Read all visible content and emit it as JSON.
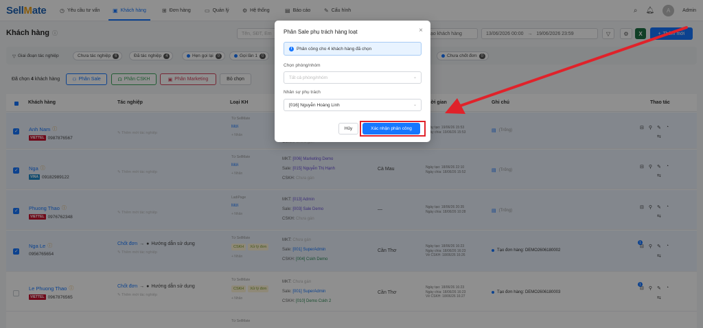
{
  "brand": {
    "logo_left": "Sell",
    "logo_mid": "M",
    "logo_right": "ate"
  },
  "nav": [
    {
      "label": "Yêu cầu tư vấn",
      "icon": "clock-icon"
    },
    {
      "label": "Khách hàng",
      "icon": "contacts-icon"
    },
    {
      "label": "Đơn hàng",
      "icon": "cart-icon"
    },
    {
      "label": "Quản lý",
      "icon": "folder-icon"
    },
    {
      "label": "Hệ thống",
      "icon": "gear-icon"
    },
    {
      "label": "Báo cáo",
      "icon": "chart-icon"
    },
    {
      "label": "Cấu hình",
      "icon": "wrench-icon"
    }
  ],
  "user": {
    "initial": "A",
    "name": "Admin"
  },
  "page": {
    "title": "Khách hàng",
    "search_placeholder": "Tên, SĐT, Em",
    "date_type": "tạo khách hàng",
    "date_from": "13/06/2026 00:00",
    "date_sep": "→",
    "date_to": "19/06/2026 23:59",
    "excel_label": "X",
    "add_label": "Thêm mới"
  },
  "filters": [
    {
      "label": "Giai đoạn tác nghiệp",
      "count": "",
      "kind": "plain"
    },
    {
      "label": "Chưa tác nghiệp",
      "count": "6",
      "kind": "count"
    },
    {
      "label": "Đã tác nghiệp",
      "count": "4",
      "kind": "count"
    },
    {
      "label": "Hẹn gọi lại",
      "count": "0",
      "kind": "dot"
    },
    {
      "label": "Gọi lần 1",
      "count": "0",
      "kind": "dot"
    },
    {
      "label": "Chưa chốt đơn",
      "count": "0",
      "kind": "dot"
    }
  ],
  "bulk": {
    "selected_prefix": "Đã chọn",
    "selected_count": "4",
    "selected_suffix": "khách hàng",
    "btn_sale": "Phân Sale",
    "btn_cskh": "Phân CSKH",
    "btn_marketing": "Phân Marketing",
    "btn_clear": "Bỏ chọn"
  },
  "columns": {
    "customer": "Khách hàng",
    "task": "Tác nghiệp",
    "lead_type": "Loại KH",
    "time": "Thời gian",
    "note": "Ghi chú",
    "actions": "Thao tác"
  },
  "rows": [
    {
      "name": "Anh Nam",
      "carrier": "VIETTEL",
      "phone": "0987876567",
      "selected": true,
      "task": "",
      "task_note": "✎ Thêm mới tác nghiệp",
      "source": "Từ SellMate",
      "status": "Mới",
      "more": "+ Nhân",
      "mkt_label": "",
      "mkt_value": "",
      "sale_label": "",
      "sale_value": "",
      "cskh_label": "CSKH:",
      "cskh_value": "Chưa gán",
      "region": "",
      "created": "Ngày tạo: 19/06/26 15:53",
      "assigned": "Ngày chia: 19/06/26 15:53",
      "cskh_date": "",
      "note": "(Trống)",
      "note_dark": false,
      "has_badge": false
    },
    {
      "name": "Nga",
      "carrier": "VINA",
      "phone": "09182989122",
      "selected": true,
      "task": "",
      "task_note": "✎ Thêm mới tác nghiệp",
      "source": "Từ SellMate",
      "status": "Mới",
      "more": "+ Nhân",
      "mkt_label": "MKT:",
      "mkt_value": "[006] Marketing Demo",
      "sale_label": "Sale:",
      "sale_value": "[015] Nguyễn Thị Hạnh",
      "cskh_label": "CSKH:",
      "cskh_value": "Chưa gán",
      "region": "Cà Mau",
      "created": "Ngày tạo: 18/06/26 22:10",
      "assigned": "Ngày chia: 18/06/26 15:52",
      "cskh_date": "",
      "note": "(Trống)",
      "note_dark": false,
      "has_badge": false
    },
    {
      "name": "Phuong Thao",
      "carrier": "VIETTEL",
      "phone": "0976762348",
      "selected": true,
      "task": "",
      "task_note": "✎ Thêm mới tác nghiệp",
      "source": "LadiPage",
      "status": "Mới",
      "more": "+ Nhân",
      "mkt_label": "MKT:",
      "mkt_value": "[013] Admin",
      "sale_label": "Sale:",
      "sale_value": "[003] Sale Demo",
      "cskh_label": "CSKH:",
      "cskh_value": "Chưa gán",
      "region": "—",
      "created": "Ngày tạo: 18/06/26 20:35",
      "assigned": "Ngày chia: 18/06/26 10:28",
      "cskh_date": "",
      "note": "(Trống)",
      "note_dark": false,
      "has_badge": false
    },
    {
      "name": "Nga Le",
      "carrier": "",
      "phone": "0956765654",
      "selected": true,
      "task": "Chốt đơn",
      "task_arrow": "→",
      "task_extra": "Hướng dẫn sử dụng",
      "task_note": "✎ Thêm mới tác nghiệp",
      "source": "Từ SellMate",
      "status": "",
      "tag1": "CSKH",
      "tag2": "Xử lý đơn",
      "more": "+ Nhân",
      "mkt_label": "MKT:",
      "mkt_value": "Chưa gán",
      "sale_label": "Sale:",
      "sale_value": "[001] SuperAdmin",
      "cskh_label": "CSKH:",
      "cskh_value": "[004] Cskh Demo",
      "region": "Cần Thơ",
      "created": "Ngày tạo: 18/06/26 16:23",
      "assigned": "Ngày chia: 18/06/26 16:23",
      "cskh_date": "Về CSKH: 18/06/26 16:26",
      "note": "Tạo đơn hàng: DEMO2606180002",
      "note_dark": true,
      "has_badge": true,
      "badge": "1"
    },
    {
      "name": "Le Phuong Thao",
      "carrier": "VIETTEL",
      "phone": "0967876565",
      "selected": false,
      "task": "Chốt đơn",
      "task_arrow": "→",
      "task_extra": "Hướng dẫn sử dụng",
      "task_note": "✎ Thêm mới tác nghiệp",
      "source": "Từ SellMate",
      "status": "",
      "tag1": "CSKH",
      "tag2": "Xử lý đơn",
      "more": "+ Nhân",
      "mkt_label": "MKT:",
      "mkt_value": "Chưa gán",
      "sale_label": "Sale:",
      "sale_value": "[001] SuperAdmin",
      "cskh_label": "CSKH:",
      "cskh_value": "[010] Demo Cskh 2",
      "region": "Cần Thơ",
      "created": "Ngày tạo: 18/06/26 16:23",
      "assigned": "Ngày chia: 18/06/26 16:23",
      "cskh_date": "Về CSKH: 18/06/26 16:27",
      "note": "Tạo đơn hàng: DEMO2606180003",
      "note_dark": true,
      "has_badge": true,
      "badge": "1"
    }
  ],
  "modal": {
    "title": "Phân Sale phụ trách hàng loạt",
    "close": "×",
    "alert": "Phân công cho 4 khách hàng đã chọn",
    "alert_icon": "i",
    "dept_label": "Chọn phòng/nhóm",
    "dept_placeholder": "Tất cả phòng/nhóm",
    "staff_label": "Nhân sự phụ trách",
    "staff_value": "[016] Nguyễn Hoàng Linh",
    "cancel": "Hủy",
    "confirm": "Xác nhận phân công"
  },
  "colors": {
    "accent": "#1677ff",
    "annotation": "#e0222a",
    "excel": "#1e7145"
  }
}
